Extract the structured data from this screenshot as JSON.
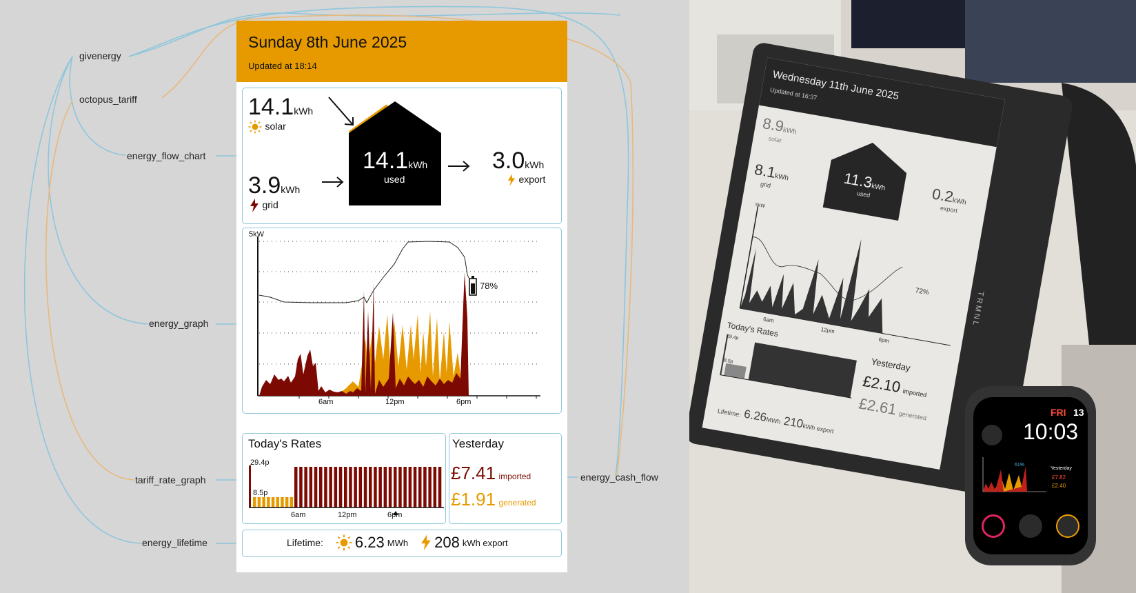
{
  "labels": {
    "givenergy": "givenergy",
    "octopus_tariff": "octopus_tariff",
    "energy_flow_chart": "energy_flow_chart",
    "energy_graph": "energy_graph",
    "tariff_rate_graph": "tariff_rate_graph",
    "energy_lifetime": "energy_lifetime",
    "energy_cash_flow": "energy_cash_flow"
  },
  "colors": {
    "header": "#e79a00",
    "grid_red": "#7c0a02",
    "solar": "#e79a00",
    "panel_border": "#8ec6dc",
    "connector_blue": "#8ec6dc",
    "connector_orange": "#e8b87a"
  },
  "dashboard": {
    "title": "Sunday 8th June 2025",
    "updated": "Updated at 18:14",
    "flow": {
      "solar_value": "14.1",
      "solar_unit": "kWh",
      "solar_label": "solar",
      "grid_value": "3.9",
      "grid_unit": "kWh",
      "grid_label": "grid",
      "used_value": "14.1",
      "used_unit": "kWh",
      "used_label": "used",
      "export_value": "3.0",
      "export_unit": "kWh",
      "export_label": "export",
      "icons": [
        "sun-icon",
        "bolt-icon",
        "arrow-icon",
        "house-icon"
      ]
    },
    "graph": {
      "y_unit": "5kW",
      "battery_label": "78%",
      "battery_level": 0.78,
      "x_ticks": [
        "6am",
        "12pm",
        "6pm"
      ]
    },
    "rates": {
      "title": "Today's Rates",
      "high_label": "29.4p",
      "low_label": "8.5p",
      "x_ticks": [
        "6am",
        "12pm",
        "6pm"
      ]
    },
    "yesterday": {
      "title": "Yesterday",
      "imported_value": "£7.41",
      "imported_label": "imported",
      "generated_value": "£1.91",
      "generated_label": "generated"
    },
    "lifetime": {
      "label": "Lifetime:",
      "solar_value": "6.23",
      "solar_unit": "MWh",
      "export_value": "208",
      "export_unit": "kWh export"
    }
  },
  "eink": {
    "title": "Wednesday 11th June 2025",
    "updated": "Updated at 16:37",
    "solar_value": "8.9",
    "solar_unit": "kWh",
    "solar_label": "solar",
    "grid_value": "8.1",
    "grid_unit": "kWh",
    "grid_label": "grid",
    "used_value": "11.3",
    "used_unit": "kWh",
    "used_label": "used",
    "export_value": "0.2",
    "export_unit": "kWh",
    "export_label": "export",
    "y_unit": "5kW",
    "battery_label": "72%",
    "x_ticks": [
      "6am",
      "12pm",
      "6pm"
    ],
    "rates_title": "Today's Rates",
    "rate_high": "29.4p",
    "rate_low": "8.5p",
    "yesterday_title": "Yesterday",
    "imported_value": "£2.10",
    "imported_label": "imported",
    "generated_value": "£2.61",
    "generated_label": "generated",
    "lifetime_label": "Lifetime:",
    "lifetime_solar": "6.26",
    "lifetime_solar_unit": "MWh",
    "lifetime_export": "210",
    "lifetime_export_unit": "kWh export",
    "brand": "TRMNL"
  },
  "watch": {
    "day": "FRI",
    "date": "13",
    "time": "10:03",
    "battery_label": "61%",
    "yesterday_title": "Yesterday",
    "imported": "£7.82",
    "generated": "£2.40"
  }
}
